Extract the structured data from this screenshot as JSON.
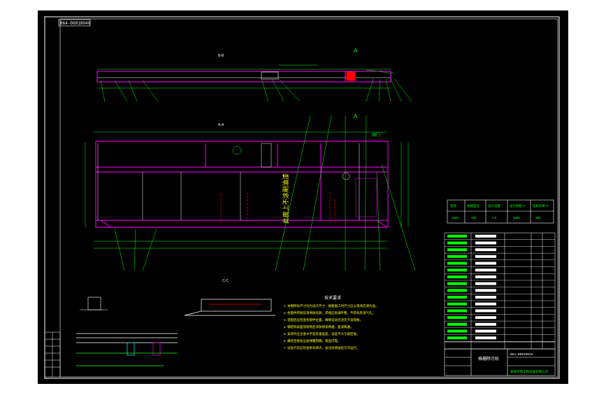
{
  "sheet": {
    "code": "B64-00010040",
    "section_mark": "A",
    "section_mark_2": "A",
    "view_label_top": "B-B",
    "view_label_front": "A-A",
    "view_label_detail": "C-C"
  },
  "tech_notes": {
    "title": "技术要求",
    "lines": [
      "1. 本图所标尺寸均为设计尺寸，按图施工时尺寸应以现场实测为准。",
      "2. 各部件焊接前须清除毛刺，焊缝应饱满平整，不得有夹渣气孔。",
      "3. 装配后应检查各部件位置，确保运动灵活无卡滞现象。",
      "4. 钢结构表面须除锈后涂防锈漆两遍，面漆两遍。",
      "5. 安装时应注意水平度及垂直度，误差不大于规定值。",
      "6. 螺栓连接处应加弹簧垫圈，紧固可靠。",
      "7. 试运行前应检查各润滑点，加注润滑油后方可运行。"
    ]
  },
  "rotated_label": "此面上不涂刷油漆",
  "tag_label": "阀门",
  "param_table": {
    "headers": [
      "名称",
      "规格型号",
      "设计流量",
      "设计扬程 H",
      "电机功率 N"
    ],
    "values": [
      "2500",
      "750",
      "4.0",
      "6000",
      "380"
    ]
  },
  "title_block": {
    "drawing_name": "格栅除污机",
    "drawing_no": "B64-00010040",
    "company": "某某环境工程设备有限公司"
  }
}
